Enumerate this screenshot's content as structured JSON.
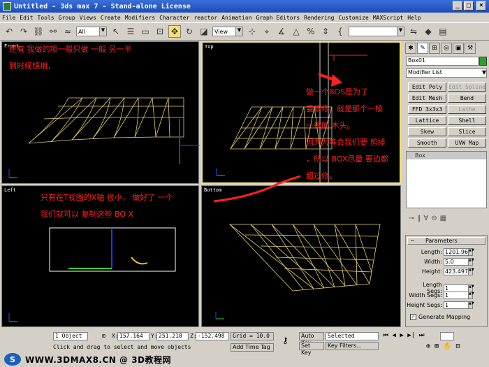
{
  "window": {
    "title": "Untitled - 3ds max 7 - Stand-alone License"
  },
  "menu": [
    "File",
    "Edit",
    "Tools",
    "Group",
    "Views",
    "Create",
    "Modifiers",
    "Character",
    "reactor",
    "Animation",
    "Graph Editors",
    "Rendering",
    "Customize",
    "MAXScript",
    "Help"
  ],
  "toolbar": {
    "selection_filter": "All",
    "ref_coord": "View"
  },
  "viewports": {
    "front": {
      "label": "Front"
    },
    "top": {
      "label": "Top"
    },
    "left": {
      "label": "Left"
    },
    "bottom": {
      "label": "Bottom"
    }
  },
  "annotations": {
    "a1": "还有  我做的项一般只做  一般  另一半",
    "a2": "到时候镜相，",
    "b1": "做一个BOS是为了",
    "b2": "要被修，就是那个一棱",
    "b3": "一被的  木头。",
    "b4": "因为为等会我们要    剪掉",
    "b5": "，所以 BOX尽量 要边都",
    "b6": "超过修。",
    "c1": "只有在T视图的X轴  很小，  做好了  一个",
    "c2": "我们就可以  复制这些  BO  X"
  },
  "command_panel": {
    "object_name": "Box01",
    "modifier_list": "Modifier List",
    "modifiers": [
      "Edit Poly",
      "Edit Spline",
      "Edit Mesh",
      "Bend",
      "FFD 3x3x3",
      "Lathe",
      "Lattice",
      "Shell",
      "Skew",
      "Slice",
      "Smooth",
      "UVW Map"
    ],
    "stack_item": "Box",
    "params_title": "Parameters",
    "length_label": "Length:",
    "length_value": "1201.96",
    "width_label": "Width:",
    "width_value": "5.0",
    "height_label": "Height:",
    "height_value": "423.497",
    "lsegs_label": "Length Segs:",
    "lsegs_value": "1",
    "wsegs_label": "Width Segs:",
    "wsegs_value": "1",
    "hsegs_label": "Height Segs:",
    "hsegs_value": "1",
    "gen_mapping": "Generate Mapping",
    "color": "#2e9e2e"
  },
  "status": {
    "selected_count": "1 Object",
    "x_label": "X:",
    "x_value": "157.164",
    "y_label": "Y:",
    "y_value": "251.218",
    "z_label": "Z:",
    "z_value": "-152.498",
    "grid": "Grid = 10.0",
    "prompt": "Click and drag to select and move objects",
    "add_time_tag": "Add Time Tag",
    "auto_key": "Auto Key",
    "set_key": "Set Key",
    "key_filter_value": "Selected",
    "key_filters": "Key Filters..."
  },
  "watermark": {
    "text": "WWW.3DMAX8.CN @ 3D教程网",
    "logo": "S"
  }
}
